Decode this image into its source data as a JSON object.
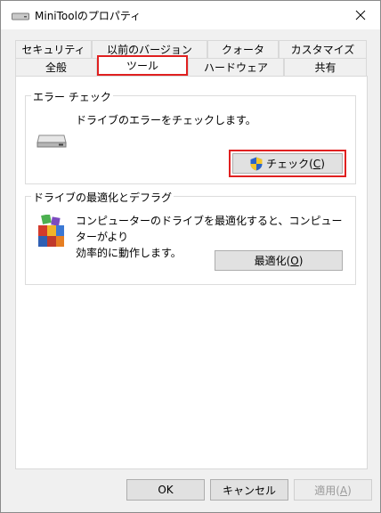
{
  "window": {
    "title": "MiniToolのプロパティ"
  },
  "tabs_row1": [
    {
      "label": "セキュリティ"
    },
    {
      "label": "以前のバージョン"
    },
    {
      "label": "クォータ"
    },
    {
      "label": "カスタマイズ"
    }
  ],
  "tabs_row2": [
    {
      "label": "全般"
    },
    {
      "label": "ツール"
    },
    {
      "label": "ハードウェア"
    },
    {
      "label": "共有"
    }
  ],
  "error_check": {
    "title": "エラー チェック",
    "description": "ドライブのエラーをチェックします。",
    "button_label": "チェック(",
    "button_key": "C",
    "button_suffix": ")"
  },
  "optimize": {
    "title": "ドライブの最適化とデフラグ",
    "description_line1": "コンピューターのドライブを最適化すると、コンピューターがより",
    "description_line2": "効率的に動作します。",
    "button_label": "最適化(",
    "button_key": "O",
    "button_suffix": ")"
  },
  "footer": {
    "ok_label": "OK",
    "cancel_label": "キャンセル",
    "apply_label": "適用(",
    "apply_key": "A",
    "apply_suffix": ")"
  },
  "colors": {
    "highlight_red": "#e02020",
    "window_bg": "#f0f0f0",
    "panel_bg": "#ffffff"
  }
}
